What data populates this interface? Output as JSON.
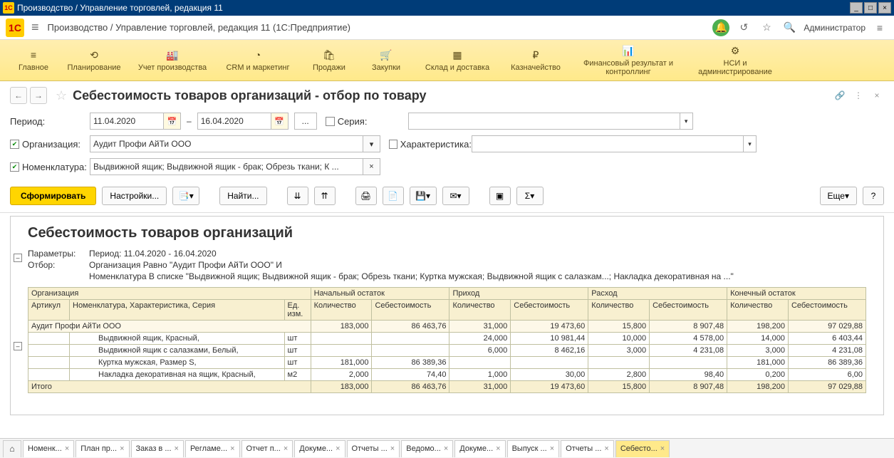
{
  "window": {
    "title": "Производство / Управление торговлей, редакция 11"
  },
  "header": {
    "subtitle": "Производство / Управление торговлей, редакция 11  (1С:Предприятие)",
    "admin": "Администратор"
  },
  "sections": [
    {
      "icon": "≡",
      "label": "Главное"
    },
    {
      "icon": "⟲",
      "label": "Планирование"
    },
    {
      "icon": "🏭",
      "label": "Учет производства"
    },
    {
      "icon": "◔",
      "label": "CRM и маркетинг"
    },
    {
      "icon": "🛍",
      "label": "Продажи"
    },
    {
      "icon": "🛒",
      "label": "Закупки"
    },
    {
      "icon": "▦",
      "label": "Склад и доставка"
    },
    {
      "icon": "₽",
      "label": "Казначейство"
    },
    {
      "icon": "📊",
      "label": "Финансовый результат и контроллинг"
    },
    {
      "icon": "⚙",
      "label": "НСИ и администрирование"
    }
  ],
  "page": {
    "title": "Себестоимость товаров организаций - отбор по товару"
  },
  "filters": {
    "period_label": "Период:",
    "date_from": "11.04.2020",
    "date_to": "16.04.2020",
    "series_label": "Серия:",
    "org_label": "Организация:",
    "org_value": "Аудит Профи АйТи ООО",
    "char_label": "Характеристика:",
    "nom_label": "Номенклатура:",
    "nom_value": "Выдвижной ящик; Выдвижной ящик - брак; Обрезь ткани; К ..."
  },
  "toolbar": {
    "run": "Сформировать",
    "settings": "Настройки...",
    "find": "Найти...",
    "more": "Еще"
  },
  "report": {
    "title": "Себестоимость товаров организаций",
    "params_label": "Параметры:",
    "params_value": "Период: 11.04.2020 - 16.04.2020",
    "filter_label": "Отбор:",
    "filter_value1": "Организация Равно \"Аудит Профи АйТи ООО\" И",
    "filter_value2": "Номенклатура В списке \"Выдвижной ящик; Выдвижной ящик - брак; Обрезь ткани; Куртка мужская; Выдвижной ящик с салазкам...; Накладка декоративная на ...\"",
    "headers": {
      "org": "Организация",
      "start": "Начальный остаток",
      "in": "Приход",
      "out": "Расход",
      "end": "Конечный остаток",
      "art": "Артикул",
      "nom": "Номенклатура, Характеристика, Серия",
      "unit": "Ед. изм.",
      "qty": "Количество",
      "cost": "Себестоимость"
    },
    "group_name": "Аудит Профи АйТи ООО",
    "rows": [
      {
        "nom": "Выдвижной ящик, Красный,",
        "unit": "шт",
        "sq": "",
        "sc": "",
        "iq": "24,000",
        "ic": "10 981,44",
        "oq": "10,000",
        "oc": "4 578,00",
        "eq": "14,000",
        "ec": "6 403,44"
      },
      {
        "nom": "Выдвижной ящик с салазками, Белый,",
        "unit": "шт",
        "sq": "",
        "sc": "",
        "iq": "6,000",
        "ic": "8 462,16",
        "oq": "3,000",
        "oc": "4 231,08",
        "eq": "3,000",
        "ec": "4 231,08"
      },
      {
        "nom": "Куртка мужская, Размер S,",
        "unit": "шт",
        "sq": "181,000",
        "sc": "86 389,36",
        "iq": "",
        "ic": "",
        "oq": "",
        "oc": "",
        "eq": "181,000",
        "ec": "86 389,36"
      },
      {
        "nom": "Накладка декоративная на ящик, Красный,",
        "unit": "м2",
        "sq": "2,000",
        "sc": "74,40",
        "iq": "1,000",
        "ic": "30,00",
        "oq": "2,800",
        "oc": "98,40",
        "eq": "0,200",
        "ec": "6,00"
      }
    ],
    "group_totals": {
      "sq": "183,000",
      "sc": "86 463,76",
      "iq": "31,000",
      "ic": "19 473,60",
      "oq": "15,800",
      "oc": "8 907,48",
      "eq": "198,200",
      "ec": "97 029,88"
    },
    "totals_label": "Итого",
    "totals": {
      "sq": "183,000",
      "sc": "86 463,76",
      "iq": "31,000",
      "ic": "19 473,60",
      "oq": "15,800",
      "oc": "8 907,48",
      "eq": "198,200",
      "ec": "97 029,88"
    }
  },
  "tabs": [
    "Номенк...",
    "План пр...",
    "Заказ в ...",
    "Регламе...",
    "Отчет п...",
    "Докуме...",
    "Отчеты ...",
    "Ведомо...",
    "Докуме...",
    "Выпуск ...",
    "Отчеты ...",
    "Себесто..."
  ]
}
